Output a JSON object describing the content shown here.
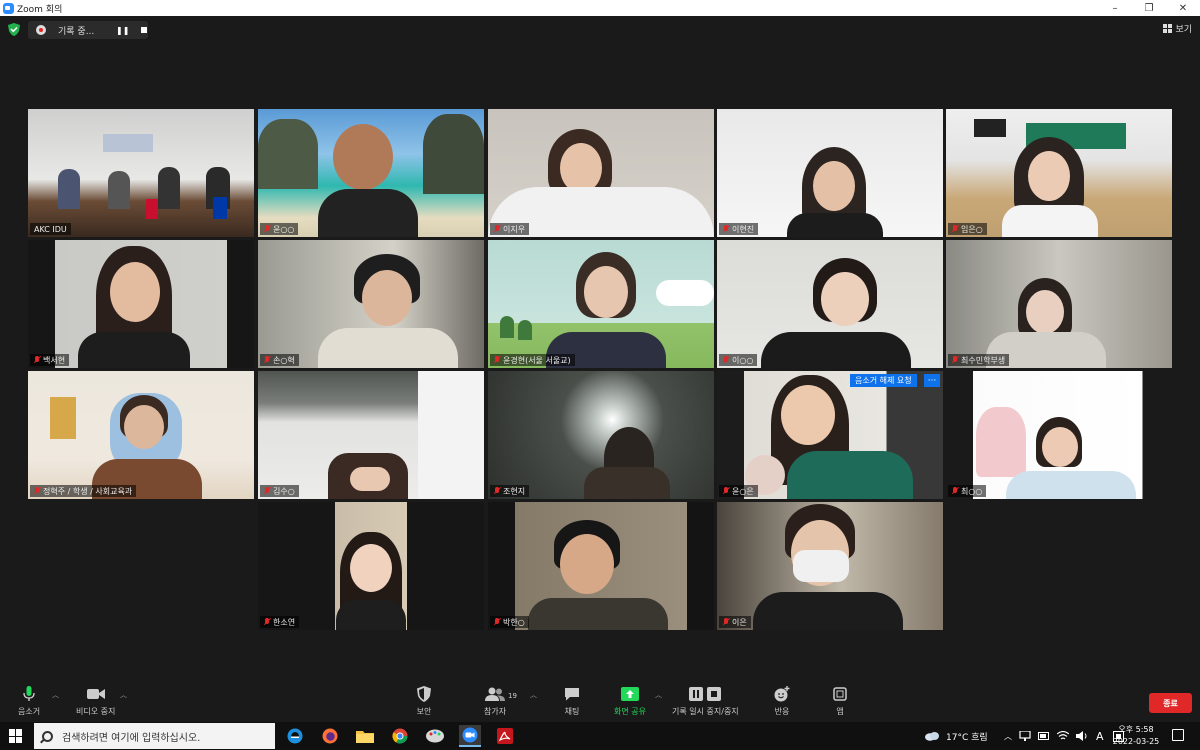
{
  "window": {
    "title": "Zoom 회의",
    "minimize": "–",
    "maximize": "❐",
    "close": "✕"
  },
  "recording": {
    "label": "기록 중...",
    "pause": "❚❚"
  },
  "view": {
    "label": "보기"
  },
  "tiles": [
    {
      "name": "AKC IDU",
      "muted": false
    },
    {
      "name": "윤○○",
      "muted": true
    },
    {
      "name": "이지우",
      "muted": true
    },
    {
      "name": "이현진",
      "muted": true
    },
    {
      "name": "임은○",
      "muted": true
    },
    {
      "name": "백서현",
      "muted": true
    },
    {
      "name": "손○혁",
      "muted": true
    },
    {
      "name": "윤경현(서울 서울교)",
      "muted": true
    },
    {
      "name": "이○○",
      "muted": true
    },
    {
      "name": "최수민학부생",
      "muted": true
    },
    {
      "name": "정혁주 / 학생 / 사회교육과",
      "muted": true
    },
    {
      "name": "김수○",
      "muted": true
    },
    {
      "name": "조현지",
      "muted": true
    },
    {
      "name": "윤○은",
      "muted": true
    },
    {
      "name": "최○○",
      "muted": true
    },
    {
      "name": "한소연",
      "muted": true
    },
    {
      "name": "박한○",
      "muted": true
    },
    {
      "name": "이은",
      "muted": true
    }
  ],
  "unmute_request": {
    "label": "음소거 해제 요청",
    "more": "···"
  },
  "toolbar": {
    "mute": "음소거",
    "video": "비디오 중지",
    "security": "보안",
    "participants": "참가자",
    "participants_count": "19",
    "chat": "채팅",
    "share": "화면 공유",
    "pause_record": "기록 일시 중지/중지",
    "reactions": "반응",
    "apps": "앱",
    "end": "종료"
  },
  "taskbar": {
    "search_placeholder": "검색하려면 여기에 입력하십시오.",
    "weather": "17°C 흐림",
    "lang": "A",
    "time": "오후 5:58",
    "date": "2022-03-25"
  },
  "colors": {
    "accent": "#0e72ed",
    "end": "#e02828",
    "active_speaker": "#d6e04b",
    "share": "#23d959"
  }
}
